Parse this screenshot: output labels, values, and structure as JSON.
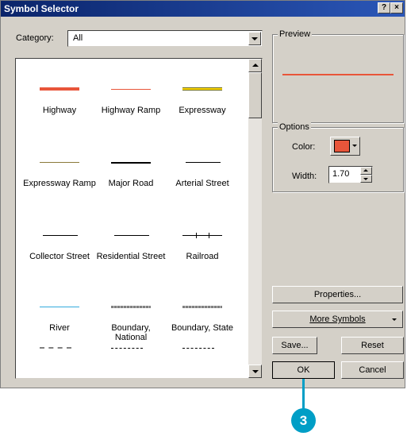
{
  "window": {
    "title": "Symbol Selector",
    "help_label": "?",
    "close_label": "×"
  },
  "category": {
    "label": "Category:",
    "value": "All"
  },
  "symbols": [
    {
      "label": "Highway",
      "color": "#e8553a",
      "style": "thick"
    },
    {
      "label": "Highway Ramp",
      "color": "#e8553a",
      "style": "thin"
    },
    {
      "label": "Expressway",
      "color": "#6b6b1f",
      "style": "double"
    },
    {
      "label": "Expressway Ramp",
      "color": "#8b7a3b",
      "style": "thin"
    },
    {
      "label": "Major Road",
      "color": "#000000",
      "style": "medium"
    },
    {
      "label": "Arterial Street",
      "color": "#000000",
      "style": "hair"
    },
    {
      "label": "Collector Street",
      "color": "#000000",
      "style": "hair"
    },
    {
      "label": "Residential Street",
      "color": "#000000",
      "style": "hair"
    },
    {
      "label": "Railroad",
      "color": "#000000",
      "style": "rail"
    },
    {
      "label": "River",
      "color": "#33aadd",
      "style": "thin"
    },
    {
      "label": "Boundary, National",
      "color": "#808080",
      "style": "dashthick"
    },
    {
      "label": "Boundary, State",
      "color": "#808080",
      "style": "dashthick"
    }
  ],
  "preview": {
    "title": "Preview",
    "line_color": "#e8553a"
  },
  "options": {
    "title": "Options",
    "color_label": "Color:",
    "color_value": "#e8553a",
    "width_label": "Width:",
    "width_value": "1.70"
  },
  "buttons": {
    "properties": "Properties...",
    "more_symbols": "More Symbols",
    "save": "Save...",
    "reset": "Reset",
    "ok": "OK",
    "cancel": "Cancel"
  },
  "callout": {
    "number": "3"
  }
}
